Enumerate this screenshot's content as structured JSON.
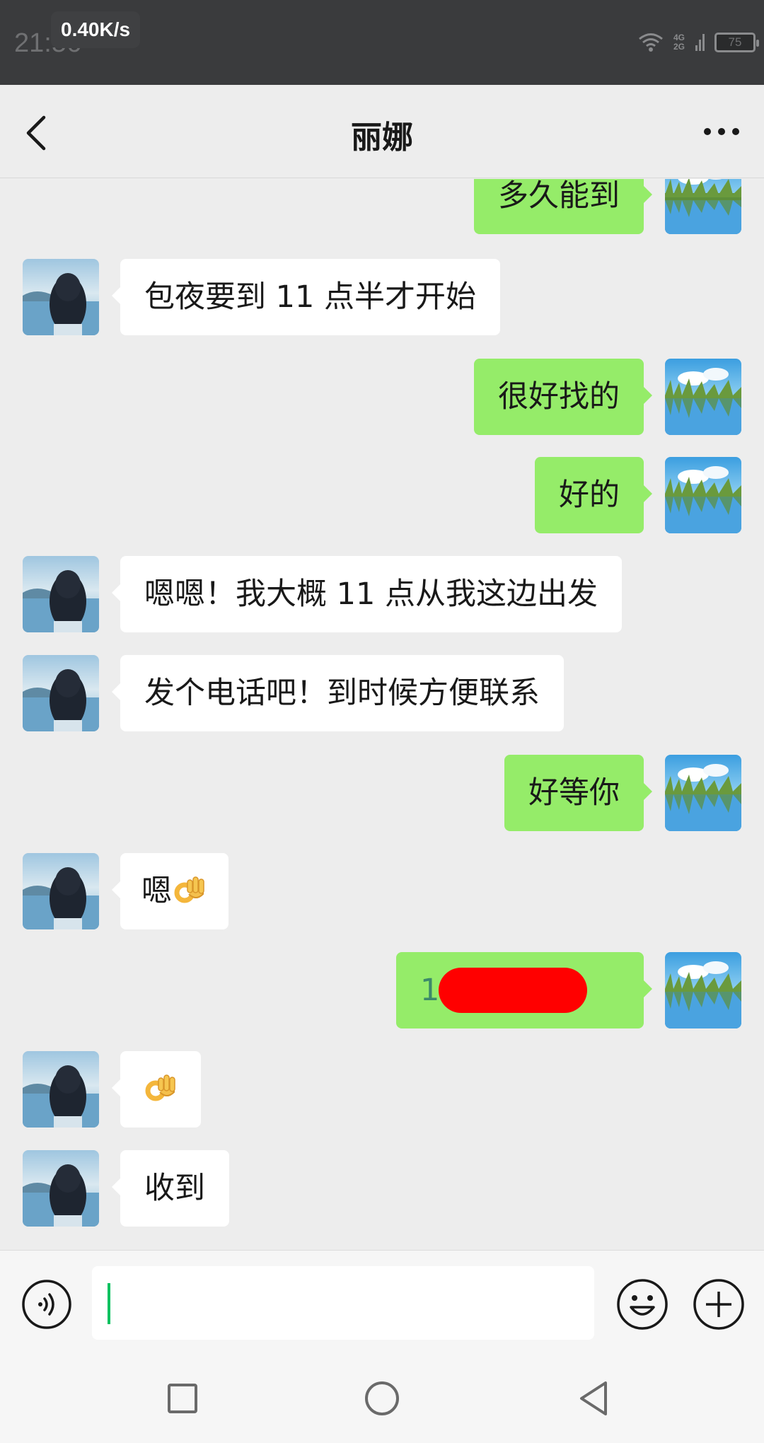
{
  "status_bar": {
    "time": "21:56",
    "net_speed": "0.40K/s",
    "network_types": [
      "4G",
      "2G"
    ],
    "battery": "75",
    "icons": [
      "wifi-icon",
      "signal-icon",
      "battery-icon"
    ]
  },
  "header": {
    "title": "丽娜",
    "back_icon": "chevron-left-icon",
    "more_icon": "more-dots-icon"
  },
  "messages": [
    {
      "side": "right",
      "text": "多久能到"
    },
    {
      "side": "left",
      "text": "包夜要到 11 点半才开始"
    },
    {
      "side": "right",
      "text": "很好找的"
    },
    {
      "side": "right",
      "text": "好的"
    },
    {
      "side": "left",
      "text": "嗯嗯！我大概 11 点从我这边出发"
    },
    {
      "side": "left",
      "text": "发个电话吧！到时候方便联系"
    },
    {
      "side": "right",
      "text": "好等你"
    },
    {
      "side": "left",
      "text": "嗯",
      "emoji": "ok-hand-emoji"
    },
    {
      "side": "right",
      "text": "15          19",
      "redacted": true
    },
    {
      "side": "left",
      "text": "",
      "emoji": "ok-hand-emoji"
    },
    {
      "side": "left",
      "text": "收到"
    }
  ],
  "input_bar": {
    "text_value": "",
    "icons": [
      "voice-icon",
      "emoji-icon",
      "plus-icon"
    ]
  },
  "nav_bar": {
    "icons": [
      "recent-apps-icon",
      "home-icon",
      "back-icon"
    ]
  },
  "colors": {
    "sent_bubble": "#95ec69",
    "received_bubble": "#ffffff",
    "chat_background": "#ededed",
    "status_bar": "#3a3b3d",
    "cursor": "#07c160",
    "redaction": "#ff0000"
  }
}
